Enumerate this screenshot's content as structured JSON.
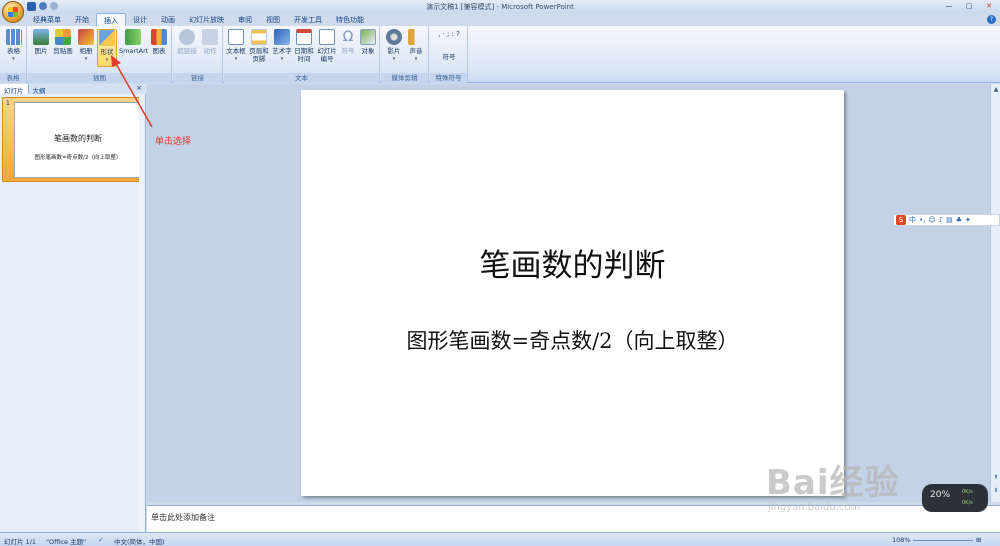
{
  "window": {
    "title": "演示文稿1 [兼容模式] - Microsoft PowerPoint"
  },
  "tabs": [
    "经典菜单",
    "开始",
    "插入",
    "设计",
    "动画",
    "幻灯片放映",
    "审阅",
    "视图",
    "开发工具",
    "特色功能"
  ],
  "active_tab": "插入",
  "ribbon": {
    "groups": {
      "table": {
        "label": "表格",
        "buttons": [
          "表格"
        ]
      },
      "illustrations": {
        "label": "插图",
        "buttons": [
          "图片",
          "剪贴画",
          "相册",
          "形状",
          "SmartArt",
          "图表"
        ]
      },
      "links": {
        "label": "链接",
        "buttons": [
          "超链接",
          "动作"
        ]
      },
      "text": {
        "label": "文本",
        "buttons": [
          "文本框",
          "页眉和页脚",
          "艺术字",
          "日期和时间",
          "幻灯片编号",
          "符号",
          "对象"
        ]
      },
      "media": {
        "label": "媒体剪辑",
        "buttons": [
          "影片",
          "声音"
        ]
      },
      "special": {
        "label": "特殊符号",
        "buttons": [
          "符号"
        ]
      }
    }
  },
  "left_panel": {
    "tabs": [
      "幻灯片",
      "大纲"
    ],
    "close": "×",
    "slides": [
      {
        "number": "1",
        "title": "笔画数的判断",
        "subtitle": "图形笔画数=奇点数/2（向上取整）"
      }
    ]
  },
  "slide": {
    "title": "笔画数的判断",
    "subtitle": "图形笔画数=奇点数/2（向上取整）"
  },
  "notes": {
    "placeholder": "单击此处添加备注"
  },
  "annotation": {
    "text": "单击选择"
  },
  "status": {
    "slide_info": "幻灯片 1/1",
    "theme": "\"Office 主题\"",
    "language": "中文(简体，中国)",
    "zoom": "108%"
  },
  "ime": {
    "logo": "S",
    "mode": "中"
  },
  "widget": {
    "percent": "20%",
    "row1": "0K/s",
    "row2": "0K/s"
  },
  "watermark": {
    "brand": "Bai经验",
    "url": "jingyan.baidu.com"
  },
  "colors": {
    "accent": "#15428b",
    "annotation": "#e23a2a",
    "hover": "#ffd76c"
  }
}
